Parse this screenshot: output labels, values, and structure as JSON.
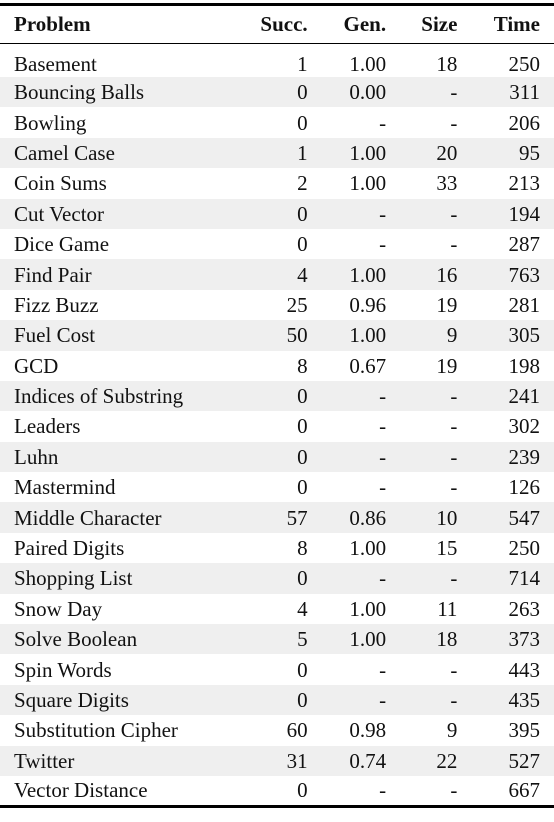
{
  "table": {
    "headers": {
      "problem": "Problem",
      "succ": "Succ.",
      "gen": "Gen.",
      "size": "Size",
      "time": "Time"
    },
    "rows": [
      {
        "problem": "Basement",
        "succ": "1",
        "gen": "1.00",
        "size": "18",
        "time": "250"
      },
      {
        "problem": "Bouncing Balls",
        "succ": "0",
        "gen": "0.00",
        "size": "-",
        "time": "311"
      },
      {
        "problem": "Bowling",
        "succ": "0",
        "gen": "-",
        "size": "-",
        "time": "206"
      },
      {
        "problem": "Camel Case",
        "succ": "1",
        "gen": "1.00",
        "size": "20",
        "time": "95"
      },
      {
        "problem": "Coin Sums",
        "succ": "2",
        "gen": "1.00",
        "size": "33",
        "time": "213"
      },
      {
        "problem": "Cut Vector",
        "succ": "0",
        "gen": "-",
        "size": "-",
        "time": "194"
      },
      {
        "problem": "Dice Game",
        "succ": "0",
        "gen": "-",
        "size": "-",
        "time": "287"
      },
      {
        "problem": "Find Pair",
        "succ": "4",
        "gen": "1.00",
        "size": "16",
        "time": "763"
      },
      {
        "problem": "Fizz Buzz",
        "succ": "25",
        "gen": "0.96",
        "size": "19",
        "time": "281"
      },
      {
        "problem": "Fuel Cost",
        "succ": "50",
        "gen": "1.00",
        "size": "9",
        "time": "305"
      },
      {
        "problem": "GCD",
        "succ": "8",
        "gen": "0.67",
        "size": "19",
        "time": "198"
      },
      {
        "problem": "Indices of Substring",
        "succ": "0",
        "gen": "-",
        "size": "-",
        "time": "241"
      },
      {
        "problem": "Leaders",
        "succ": "0",
        "gen": "-",
        "size": "-",
        "time": "302"
      },
      {
        "problem": "Luhn",
        "succ": "0",
        "gen": "-",
        "size": "-",
        "time": "239"
      },
      {
        "problem": "Mastermind",
        "succ": "0",
        "gen": "-",
        "size": "-",
        "time": "126"
      },
      {
        "problem": "Middle Character",
        "succ": "57",
        "gen": "0.86",
        "size": "10",
        "time": "547"
      },
      {
        "problem": "Paired Digits",
        "succ": "8",
        "gen": "1.00",
        "size": "15",
        "time": "250"
      },
      {
        "problem": "Shopping List",
        "succ": "0",
        "gen": "-",
        "size": "-",
        "time": "714"
      },
      {
        "problem": "Snow Day",
        "succ": "4",
        "gen": "1.00",
        "size": "11",
        "time": "263"
      },
      {
        "problem": "Solve Boolean",
        "succ": "5",
        "gen": "1.00",
        "size": "18",
        "time": "373"
      },
      {
        "problem": "Spin Words",
        "succ": "0",
        "gen": "-",
        "size": "-",
        "time": "443"
      },
      {
        "problem": "Square Digits",
        "succ": "0",
        "gen": "-",
        "size": "-",
        "time": "435"
      },
      {
        "problem": "Substitution Cipher",
        "succ": "60",
        "gen": "0.98",
        "size": "9",
        "time": "395"
      },
      {
        "problem": "Twitter",
        "succ": "31",
        "gen": "0.74",
        "size": "22",
        "time": "527"
      },
      {
        "problem": "Vector Distance",
        "succ": "0",
        "gen": "-",
        "size": "-",
        "time": "667"
      }
    ]
  },
  "colors": {
    "alt_row_background": "#efefef",
    "text": "#111111",
    "rule": "#000000"
  }
}
